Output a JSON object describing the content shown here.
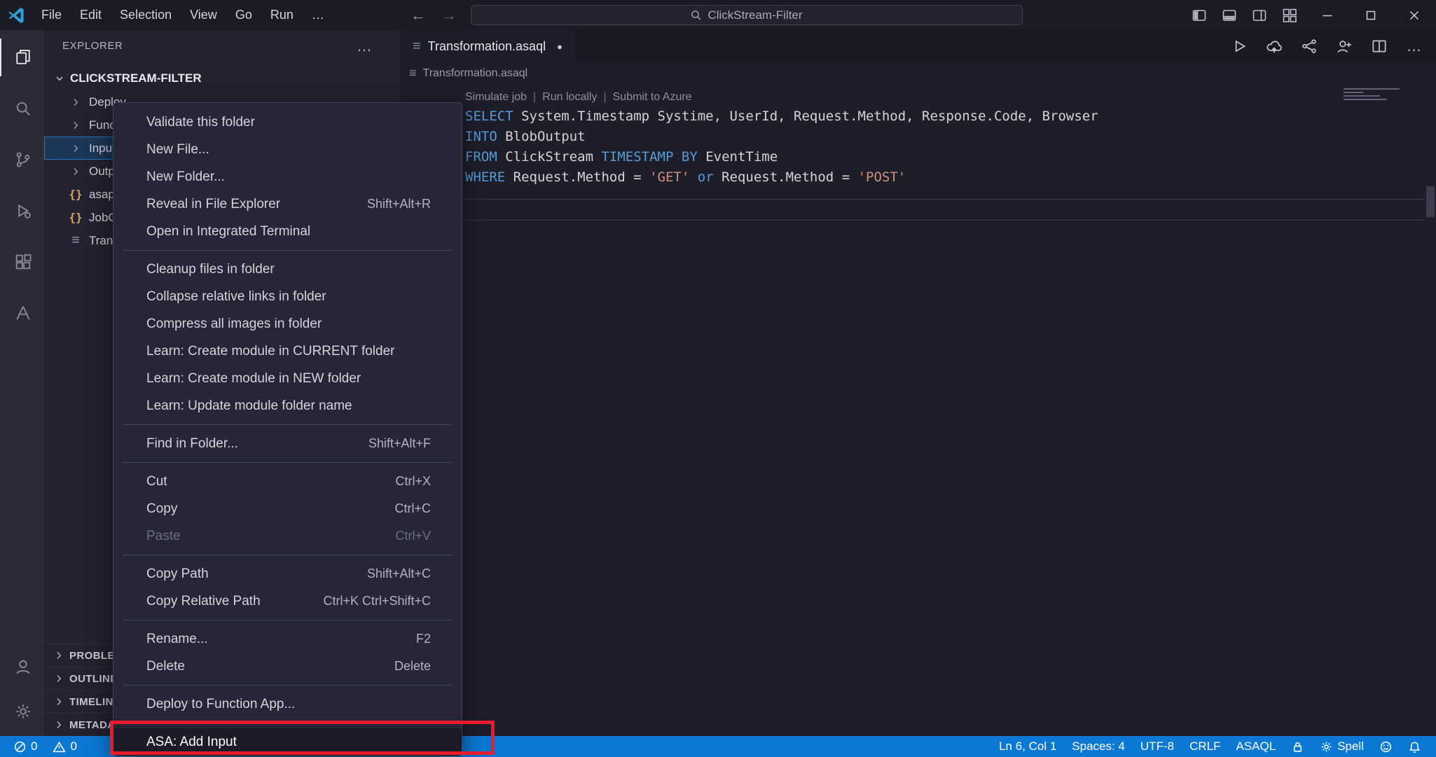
{
  "titlebar": {
    "menus": [
      "File",
      "Edit",
      "Selection",
      "View",
      "Go",
      "Run"
    ],
    "search_value": "ClickStream-Filter",
    "layout_icons": [
      "toggle-primary-sidebar",
      "toggle-panel",
      "toggle-secondary-sidebar",
      "customize-layout"
    ],
    "window_controls": [
      "minimize",
      "maximize",
      "close"
    ]
  },
  "icons": {
    "back": "←",
    "forward": "→",
    "more": "…",
    "file-list": "≡",
    "modified-dot": "●",
    "json-braces": "{}"
  },
  "activity_bar": {
    "top": [
      {
        "name": "explorer",
        "active": true
      },
      {
        "name": "search",
        "active": false
      },
      {
        "name": "source-control",
        "active": false
      },
      {
        "name": "run-debug",
        "active": false
      },
      {
        "name": "extensions",
        "active": false
      },
      {
        "name": "azure",
        "active": false
      }
    ],
    "bottom": [
      {
        "name": "accounts",
        "active": false
      },
      {
        "name": "settings",
        "active": false
      }
    ]
  },
  "sidebar": {
    "title": "EXPLORER",
    "root_folder": "CLICKSTREAM-FILTER",
    "items": [
      {
        "label": "Deploy",
        "icon": "chevron",
        "selected": false
      },
      {
        "label": "Functions",
        "icon": "chevron",
        "selected": false
      },
      {
        "label": "Inputs",
        "icon": "chevron",
        "selected": true
      },
      {
        "label": "Outputs",
        "icon": "chevron",
        "selected": false
      },
      {
        "label": "asaproj.json",
        "icon": "json",
        "selected": false
      },
      {
        "label": "JobConfig.json",
        "icon": "json",
        "selected": false
      },
      {
        "label": "Transformation.asaql",
        "icon": "list",
        "selected": false
      }
    ],
    "sections": [
      "PROBLEMS",
      "OUTLINE",
      "TIMELINE",
      "METADATA"
    ]
  },
  "context_menu": {
    "groups": [
      [
        {
          "label": "Validate this folder"
        },
        {
          "label": "New File..."
        },
        {
          "label": "New Folder..."
        },
        {
          "label": "Reveal in File Explorer",
          "shortcut": "Shift+Alt+R"
        },
        {
          "label": "Open in Integrated Terminal"
        }
      ],
      [
        {
          "label": "Cleanup files in folder"
        },
        {
          "label": "Collapse relative links in folder"
        },
        {
          "label": "Compress all images in folder"
        },
        {
          "label": "Learn: Create module in CURRENT folder"
        },
        {
          "label": "Learn: Create module in NEW folder"
        },
        {
          "label": "Learn: Update module folder name"
        }
      ],
      [
        {
          "label": "Find in Folder...",
          "shortcut": "Shift+Alt+F"
        }
      ],
      [
        {
          "label": "Cut",
          "shortcut": "Ctrl+X"
        },
        {
          "label": "Copy",
          "shortcut": "Ctrl+C"
        },
        {
          "label": "Paste",
          "shortcut": "Ctrl+V",
          "disabled": true
        }
      ],
      [
        {
          "label": "Copy Path",
          "shortcut": "Shift+Alt+C"
        },
        {
          "label": "Copy Relative Path",
          "shortcut": "Ctrl+K Ctrl+Shift+C"
        }
      ],
      [
        {
          "label": "Rename...",
          "shortcut": "F2"
        },
        {
          "label": "Delete",
          "shortcut": "Delete"
        }
      ],
      [
        {
          "label": "Deploy to Function App..."
        }
      ],
      [
        {
          "label": "ASA: Add Input",
          "focused": true
        }
      ]
    ]
  },
  "editor": {
    "tab": {
      "label": "Transformation.asaql",
      "modified": true
    },
    "breadcrumb": "Transformation.asaql",
    "codelens": [
      "Simulate job",
      "Run locally",
      "Submit to Azure"
    ],
    "actions": [
      "run",
      "submit-to-azure",
      "simulate-graph",
      "live-share",
      "split-editor",
      "more-actions"
    ],
    "code": [
      [
        {
          "t": "SELECT",
          "s": "k"
        },
        {
          "t": " System.Timestamp Systime, UserId, Request.Method, Response.Code, Browser",
          "s": "p"
        }
      ],
      [
        {
          "t": "INTO",
          "s": "k"
        },
        {
          "t": " BlobOutput",
          "s": "p"
        }
      ],
      [
        {
          "t": "FROM",
          "s": "k"
        },
        {
          "t": " ClickStream ",
          "s": "p"
        },
        {
          "t": "TIMESTAMP",
          "s": "k"
        },
        {
          "t": " ",
          "s": "p"
        },
        {
          "t": "BY",
          "s": "k"
        },
        {
          "t": " EventTime",
          "s": "p"
        }
      ],
      [
        {
          "t": "WHERE",
          "s": "k"
        },
        {
          "t": " Request.Method = ",
          "s": "p"
        },
        {
          "t": "'GET'",
          "s": "s"
        },
        {
          "t": " ",
          "s": "p"
        },
        {
          "t": "or",
          "s": "k"
        },
        {
          "t": " Request.Method = ",
          "s": "p"
        },
        {
          "t": "'POST'",
          "s": "s"
        }
      ]
    ]
  },
  "status_bar": {
    "left": [
      {
        "name": "errors",
        "icon": "error",
        "value": "0"
      },
      {
        "name": "warnings",
        "icon": "warning",
        "value": "0"
      }
    ],
    "right": [
      {
        "name": "cursor-position",
        "label": "Ln 6, Col 1"
      },
      {
        "name": "indentation",
        "label": "Spaces: 4"
      },
      {
        "name": "encoding",
        "label": "UTF-8"
      },
      {
        "name": "eol",
        "label": "CRLF"
      },
      {
        "name": "language-mode",
        "label": "ASAQL"
      },
      {
        "name": "lock",
        "icon": "lock"
      },
      {
        "name": "spell-checker",
        "icon": "gear",
        "label": "Spell"
      },
      {
        "name": "feedback",
        "icon": "smiley"
      },
      {
        "name": "notifications",
        "icon": "bell"
      }
    ]
  },
  "colors": {
    "status_bar_bg": "#0b79d4",
    "annotation_red": "#e81c2c",
    "keyword_blue": "#569cd6",
    "string_orange": "#ce9178",
    "editor_bg": "#1e1e2b"
  }
}
